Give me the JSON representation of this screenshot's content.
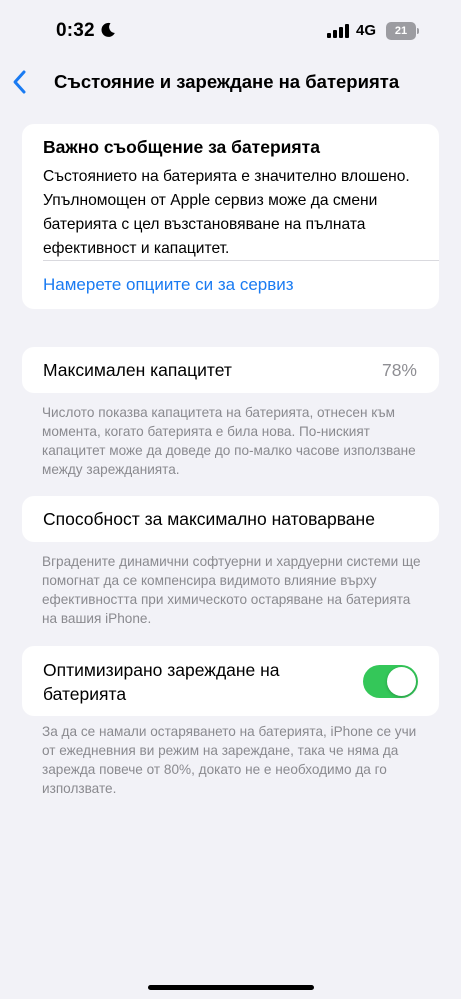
{
  "status_bar": {
    "time": "0:32",
    "network": "4G",
    "battery_level": "21",
    "icons": [
      "moon-icon",
      "signal-icon",
      "battery-icon"
    ]
  },
  "nav": {
    "back_icon": "chevron-left-icon",
    "title": "Състояние и зареждане на батерията"
  },
  "message": {
    "title": "Важно съобщение за батерията",
    "body": "Състоянието на батерията е значително влошено. Упълномощен от Apple сервиз може да смени батерията с цел възстановяване на пълната ефективност и капацитет.",
    "link": "Намерете опциите си за сервиз"
  },
  "capacity": {
    "label": "Максимален капацитет",
    "value": "78%",
    "footnote": "Числото показва капацитета на батерията, отнесен към момента, когато батерията е била нова. По-ниският капацитет може да доведе до по-малко часове използване между зарежданията."
  },
  "performance": {
    "label": "Способност за максимално натоварване",
    "footnote": "Вградените динамични софтуерни и хардуерни системи ще помогнат да се компенсира видимото влияние върху ефективността при химическото остаряване на батерията на вашия iPhone."
  },
  "optimized_charging": {
    "label": "Оптимизирано зареждане на батерията",
    "enabled": true,
    "footnote": "За да се намали остаряването на батерията, iPhone се учи от ежедневния ви режим на зареждане, така че няма да зарежда повече от 80%, докато не е необходимо да го използвате."
  },
  "colors": {
    "accent": "#1a7bf2",
    "toggle_on": "#34c759",
    "background": "#f2f2f7"
  }
}
